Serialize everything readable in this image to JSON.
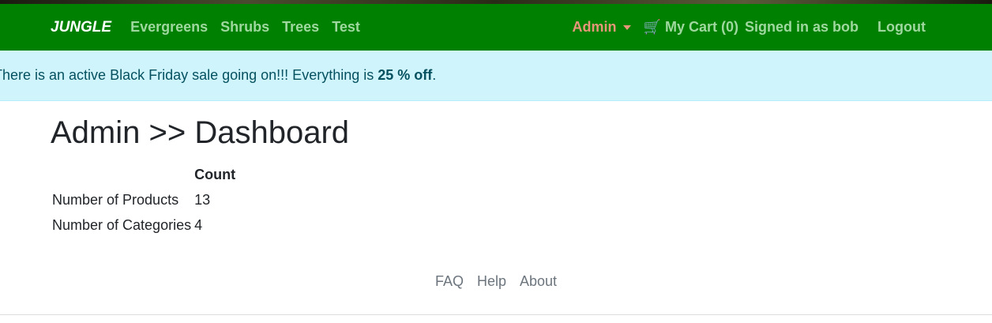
{
  "nav": {
    "brand": "JUNGLE",
    "links": [
      "Evergreens",
      "Shrubs",
      "Trees",
      "Test"
    ],
    "admin": "Admin",
    "cart": "My Cart (0)",
    "signed_in": "Signed in as bob",
    "logout": "Logout"
  },
  "banner": {
    "text": "There is an active Black Friday sale going on!!! Everything is ",
    "bold": "25 % off",
    "end": "."
  },
  "page": {
    "title": "Admin >> Dashboard",
    "table": {
      "header": "Count",
      "rows": [
        {
          "label": "Number of Products",
          "value": "13"
        },
        {
          "label": "Number of Categories",
          "value": "4"
        }
      ]
    }
  },
  "footer": {
    "links": [
      "FAQ",
      "Help",
      "About"
    ]
  },
  "colors": {
    "nav": "#008000",
    "banner": "#cff4fc"
  }
}
